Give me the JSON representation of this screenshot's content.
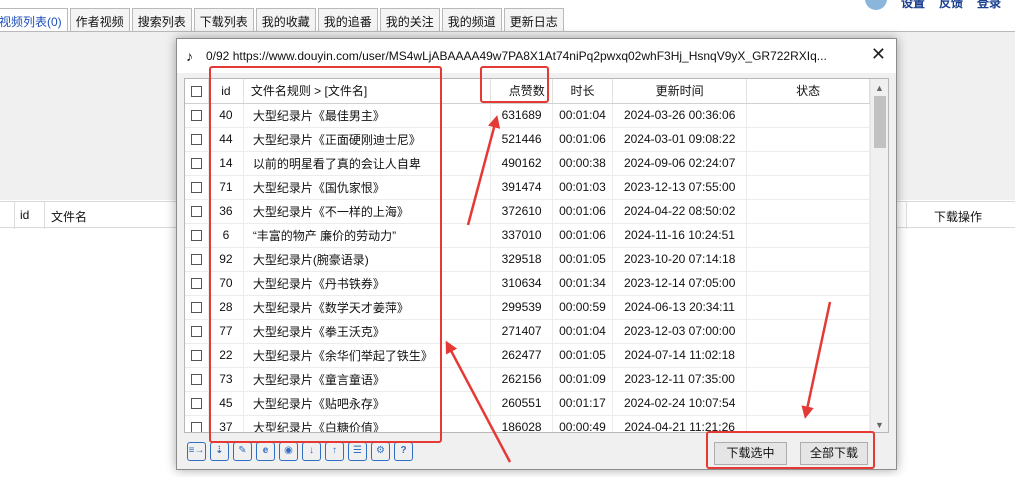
{
  "bg": {
    "tabs": [
      "视频列表(0)",
      "作者视频",
      "搜索列表",
      "下载列表",
      "我的收藏",
      "我的追番",
      "我的关注",
      "我的频道",
      "更新日志"
    ],
    "top_right": [
      "设置",
      "反馈",
      "登录"
    ],
    "list_header": {
      "id": "id",
      "filename": "文件名",
      "action": "下载操作"
    }
  },
  "dialog": {
    "title": "0/92 https://www.douyin.com/user/MS4wLjABAAAA49w7PA8X1At74niPq2pwxq02whF3Hj_HsnqV9yX_GR722RXIq...",
    "close_symbol": "✕",
    "columns": {
      "id": "id",
      "filename": "文件名规则  >  [文件名]",
      "likes": "点赞数",
      "duration": "时长",
      "updated": "更新时间",
      "status": "状态"
    },
    "rows": [
      {
        "id": "40",
        "name": "大型纪录片《最佳男主》",
        "likes": "631689",
        "duration": "00:01:04",
        "updated": "2024-03-26 00:36:06",
        "status": ""
      },
      {
        "id": "44",
        "name": "大型纪录片《正面硬刚迪士尼》",
        "likes": "521446",
        "duration": "00:01:06",
        "updated": "2024-03-01 09:08:22",
        "status": ""
      },
      {
        "id": "14",
        "name": "以前的明星看了真的会让人自卑",
        "likes": "490162",
        "duration": "00:00:38",
        "updated": "2024-09-06 02:24:07",
        "status": ""
      },
      {
        "id": "71",
        "name": "大型纪录片《国仇家恨》",
        "likes": "391474",
        "duration": "00:01:03",
        "updated": "2023-12-13 07:55:00",
        "status": ""
      },
      {
        "id": "36",
        "name": "大型纪录片《不一样的上海》",
        "likes": "372610",
        "duration": "00:01:06",
        "updated": "2024-04-22 08:50:02",
        "status": ""
      },
      {
        "id": "6",
        "name": "“丰富的物产   廉价的劳动力”",
        "likes": "337010",
        "duration": "00:01:06",
        "updated": "2024-11-16 10:24:51",
        "status": ""
      },
      {
        "id": "92",
        "name": "大型纪录片(腕豪语录)",
        "likes": "329518",
        "duration": "00:01:05",
        "updated": "2023-10-20 07:14:18",
        "status": ""
      },
      {
        "id": "70",
        "name": "大型纪录片《丹书铁券》",
        "likes": "310634",
        "duration": "00:01:34",
        "updated": "2023-12-14 07:05:00",
        "status": ""
      },
      {
        "id": "28",
        "name": "大型纪录片《数学天才姜萍》",
        "likes": "299539",
        "duration": "00:00:59",
        "updated": "2024-06-13 20:34:11",
        "status": ""
      },
      {
        "id": "77",
        "name": "大型纪录片《拳王沃克》",
        "likes": "271407",
        "duration": "00:01:04",
        "updated": "2023-12-03 07:00:00",
        "status": ""
      },
      {
        "id": "22",
        "name": "大型纪录片《余华们举起了铁生》",
        "likes": "262477",
        "duration": "00:01:05",
        "updated": "2024-07-14 11:02:18",
        "status": ""
      },
      {
        "id": "73",
        "name": "大型纪录片《童言童语》",
        "likes": "262156",
        "duration": "00:01:09",
        "updated": "2023-12-11 07:35:00",
        "status": ""
      },
      {
        "id": "45",
        "name": "大型纪录片《贴吧永存》",
        "likes": "260551",
        "duration": "00:01:17",
        "updated": "2024-02-24 10:07:54",
        "status": ""
      },
      {
        "id": "37",
        "name": "大型纪录片《白糖价值》",
        "likes": "186028",
        "duration": "00:00:49",
        "updated": "2024-04-21 11:21:26",
        "status": ""
      }
    ],
    "toolbar_icons": [
      "list-export-icon",
      "list-filter-icon",
      "edit-icon",
      "browser-icon",
      "user-icon",
      "sort-desc-icon",
      "sort-asc-icon",
      "list-check-icon",
      "settings-icon",
      "help-icon"
    ],
    "buttons": {
      "download_selected": "下载选中",
      "download_all": "全部下载"
    }
  },
  "colors": {
    "annotation_red": "#e53935",
    "link_blue": "#1b4fb8",
    "icon_blue": "#2f6fc2"
  }
}
